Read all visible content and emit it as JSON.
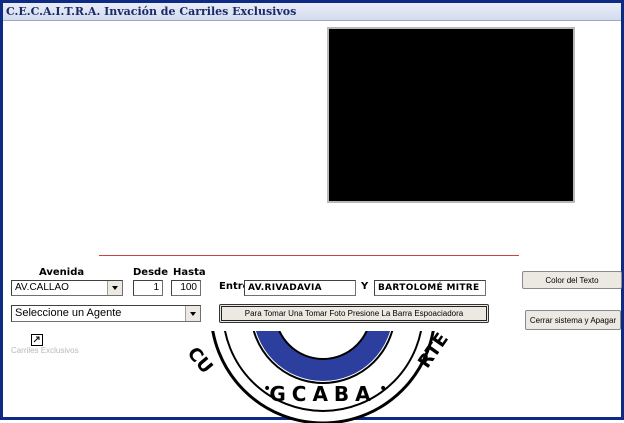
{
  "window": {
    "title": "C.E.C.A.I.T.R.A. Invación de Carriles Exclusivos"
  },
  "form": {
    "avenida_label": "Avenida",
    "avenida_value": "AV.CALLAO",
    "desde_label": "Desde",
    "desde_value": "1",
    "hasta_label": "Hasta",
    "hasta_value": "100",
    "entre_label": "Entre",
    "entre_value": "AV.RIVADAVIA",
    "y_label": "Y",
    "y_value": "BARTOLOMÉ MITRE",
    "agente_value": "Seleccione un Agente"
  },
  "buttons": {
    "tomar_foto": "Para Tomar Una Tomar Foto Presione La Barra Espoaciadora",
    "color_texto": "Color del Texto",
    "cerrar": "Cerrar sistema y Apagar"
  },
  "desktop": {
    "icon_caption": "Carriles Exclusivos"
  },
  "logo": {
    "text": "GCABA",
    "left_text": "CU",
    "right_text": "RTE"
  },
  "colors": {
    "frame": "#0d2b85",
    "logo_blue": "#2c3e9e",
    "redline": "#d04040"
  }
}
